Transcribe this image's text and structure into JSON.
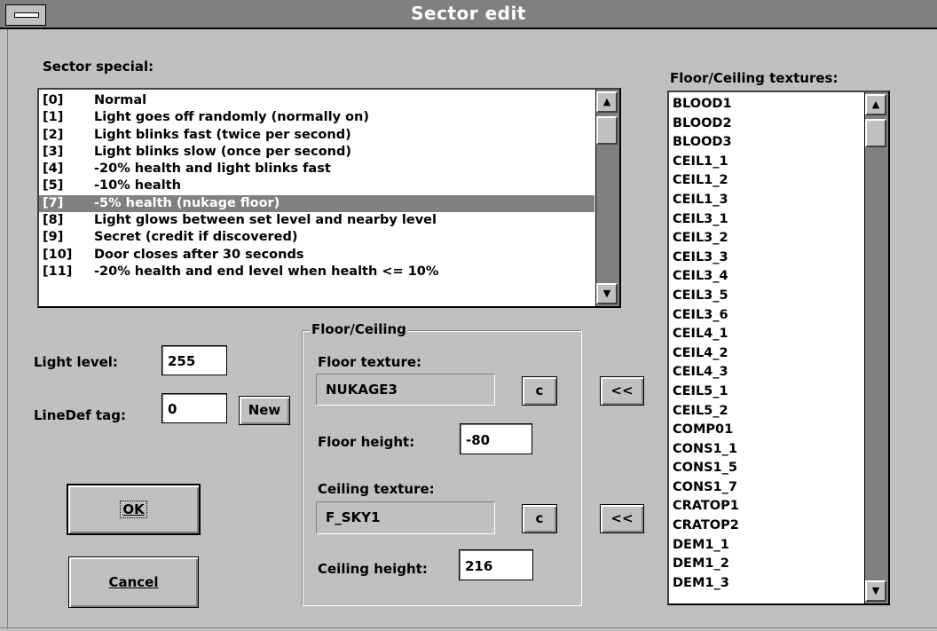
{
  "window": {
    "title": "Sector edit"
  },
  "sector_special": {
    "label": "Sector special:",
    "items": [
      {
        "code": "[0]",
        "text": "Normal"
      },
      {
        "code": "[1]",
        "text": "Light goes off randomly (normally on)"
      },
      {
        "code": "[2]",
        "text": "Light blinks fast (twice per second)"
      },
      {
        "code": "[3]",
        "text": "Light blinks slow (once per second)"
      },
      {
        "code": "[4]",
        "text": "-20% health and light blinks fast"
      },
      {
        "code": "[5]",
        "text": "-10% health"
      },
      {
        "code": "[7]",
        "text": "-5% health (nukage floor)"
      },
      {
        "code": "[8]",
        "text": "Light glows between set level and nearby level"
      },
      {
        "code": "[9]",
        "text": "Secret (credit if discovered)"
      },
      {
        "code": "[10]",
        "text": "Door closes after 30 seconds"
      },
      {
        "code": "[11]",
        "text": "-20% health and end level when health <= 10%"
      }
    ],
    "selected_index": 6
  },
  "light_level": {
    "label": "Light level:",
    "value": "255"
  },
  "linedef_tag": {
    "label": "LineDef tag:",
    "value": "0",
    "new_button": "New"
  },
  "buttons": {
    "ok": "OK",
    "cancel": "Cancel"
  },
  "floor_ceiling": {
    "group_title": "Floor/Ceiling",
    "floor_texture_label": "Floor texture:",
    "floor_texture": "NUKAGE3",
    "c_button": "c",
    "floor_height_label": "Floor height:",
    "floor_height": "-80",
    "ceiling_texture_label": "Ceiling texture:",
    "ceiling_texture": "F_SKY1",
    "ceiling_height_label": "Ceiling height:",
    "ceiling_height": "216",
    "transfer_button": "<<"
  },
  "textures": {
    "label": "Floor/Ceiling textures:",
    "items": [
      "BLOOD1",
      "BLOOD2",
      "BLOOD3",
      "CEIL1_1",
      "CEIL1_2",
      "CEIL1_3",
      "CEIL3_1",
      "CEIL3_2",
      "CEIL3_3",
      "CEIL3_4",
      "CEIL3_5",
      "CEIL3_6",
      "CEIL4_1",
      "CEIL4_2",
      "CEIL4_3",
      "CEIL5_1",
      "CEIL5_2",
      "COMP01",
      "CONS1_1",
      "CONS1_5",
      "CONS1_7",
      "CRATOP1",
      "CRATOP2",
      "DEM1_1",
      "DEM1_2",
      "DEM1_3"
    ]
  },
  "icons": {
    "scroll_up": "up-arrow-icon",
    "scroll_down": "down-arrow-icon",
    "system_menu": "system-menu-icon"
  }
}
